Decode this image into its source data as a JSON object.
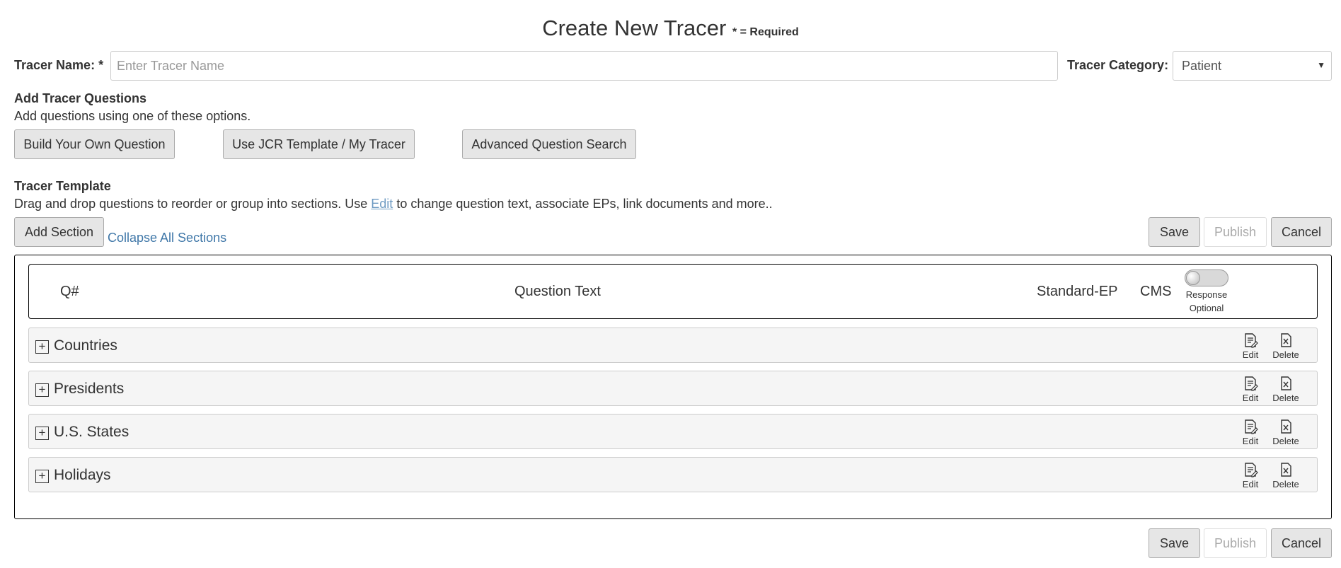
{
  "title": "Create New Tracer",
  "required_note": "* = Required",
  "form": {
    "name_label": "Tracer Name: *",
    "name_placeholder": "Enter Tracer Name",
    "category_label": "Tracer Category:",
    "category_value": "Patient"
  },
  "add_questions": {
    "heading": "Add Tracer Questions",
    "description": "Add questions using one of these options.",
    "buttons": [
      "Build Your Own Question",
      "Use JCR Template / My Tracer",
      "Advanced Question Search"
    ]
  },
  "template": {
    "heading": "Tracer Template",
    "desc_before": "Drag and drop questions to reorder or group into sections. Use ",
    "desc_link": "Edit",
    "desc_after": " to change question text, associate EPs, link documents and more..",
    "add_section": "Add Section",
    "collapse_all": "Collapse All Sections",
    "save": "Save",
    "publish": "Publish",
    "cancel": "Cancel"
  },
  "table_header": {
    "q_num": "Q#",
    "question_text": "Question Text",
    "standard_ep": "Standard-EP",
    "cms": "CMS",
    "toggle_line1": "Response",
    "toggle_line2": "Optional"
  },
  "sections": [
    {
      "name": "Countries",
      "edit": "Edit",
      "delete": "Delete"
    },
    {
      "name": "Presidents",
      "edit": "Edit",
      "delete": "Delete"
    },
    {
      "name": "U.S. States",
      "edit": "Edit",
      "delete": "Delete"
    },
    {
      "name": "Holidays",
      "edit": "Edit",
      "delete": "Delete"
    }
  ],
  "footer": {
    "save": "Save",
    "publish": "Publish",
    "cancel": "Cancel"
  }
}
